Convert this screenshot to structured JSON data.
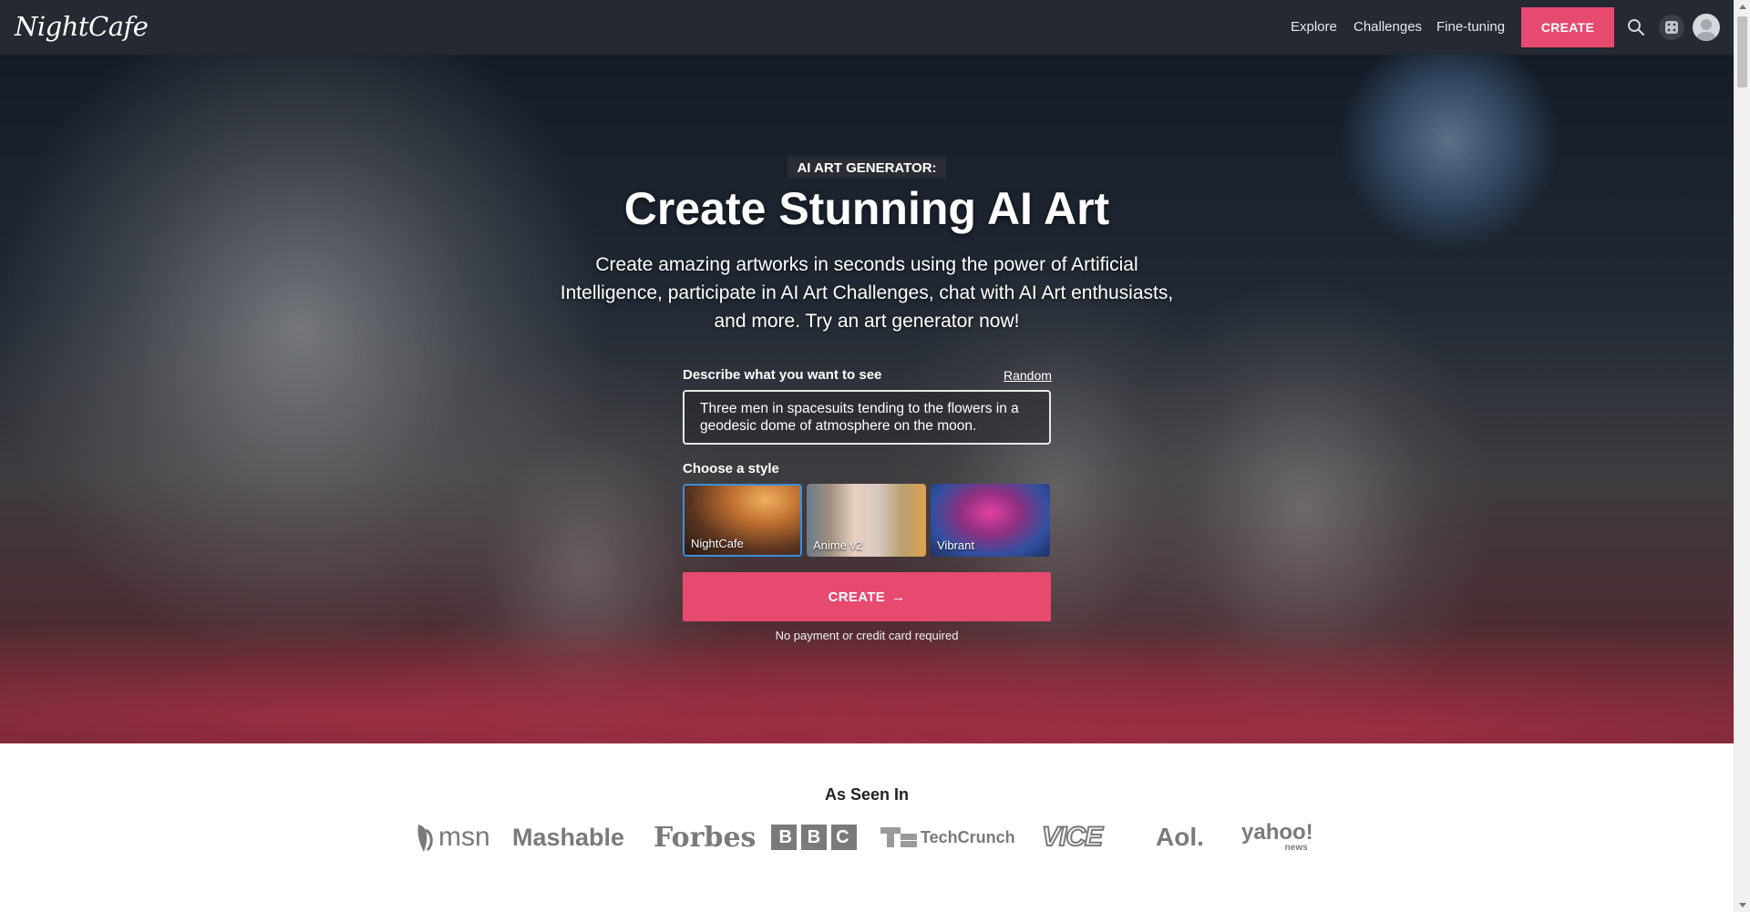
{
  "nav": {
    "logo": "NightCafe",
    "links": [
      "Explore",
      "Challenges",
      "Fine-tuning"
    ],
    "create_label": "CREATE"
  },
  "hero": {
    "tagline": "AI ART GENERATOR:",
    "headline": "Create Stunning AI Art",
    "subtext": "Create amazing artworks in seconds using the power of Artificial Intelligence, participate in AI Art Challenges, chat with AI Art enthusiasts, and more. Try an art generator now!",
    "prompt_label": "Describe what you want to see",
    "random_label": "Random",
    "prompt_value": "Three men in spacesuits tending to the flowers in a geodesic dome of atmosphere on the moon.",
    "style_label": "Choose a style",
    "styles": [
      {
        "name": "NightCafe",
        "selected": true
      },
      {
        "name": "Anime v2",
        "selected": false
      },
      {
        "name": "Vibrant",
        "selected": false
      }
    ],
    "create_label": "CREATE",
    "create_arrow": "→",
    "no_payment": "No payment or credit card required"
  },
  "press": {
    "title": "As Seen In",
    "logos": [
      "msn",
      "Mashable",
      "Forbes",
      "BBC",
      "TechCrunch",
      "VICE",
      "Aol.",
      "yahoo!",
      "news"
    ]
  },
  "colors": {
    "nav_bg": "#242932",
    "accent": "#e64a6e",
    "selected_border": "#3b8fd9"
  }
}
